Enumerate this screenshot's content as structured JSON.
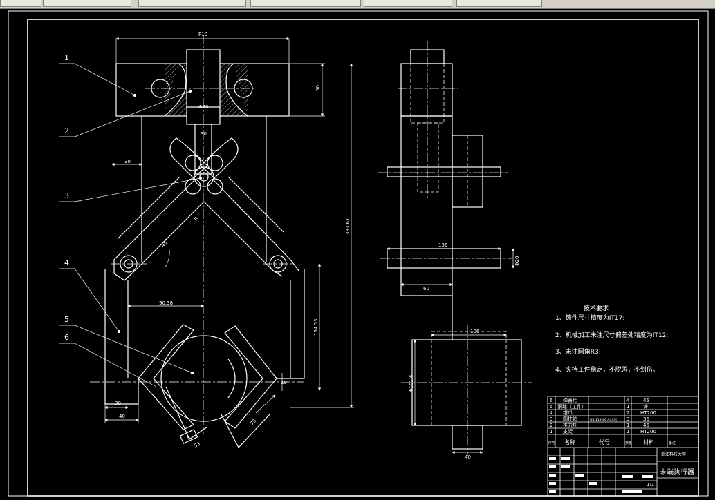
{
  "window": {
    "tabs": [
      "",
      "",
      "",
      "",
      "",
      ""
    ]
  },
  "dimensions": {
    "top_width": "P10",
    "height_50": "50",
    "bore": "Φ40",
    "slot_30": "30",
    "left_30": "30",
    "angle": "45°",
    "r": "R",
    "total_height": "333.61",
    "half_span": "90.38",
    "lower_height": "154.53",
    "bottom_30": "30",
    "bottom_40": "40",
    "jaw_78": "78",
    "jaw_5": "5",
    "jaw_53": "53",
    "gap_19": "19",
    "side_136": "136",
    "side_dia": "Φ20",
    "side_60": "60",
    "side_106": "106",
    "side_dia2": "Φ101.6",
    "side_40": "40"
  },
  "callouts": [
    "1",
    "2",
    "3",
    "4",
    "5",
    "6"
  ],
  "tech": {
    "title": "技术要求",
    "items": [
      "1、铸件尺寸精度为IT17;",
      "2、机械加工未注尺寸偏差处精度为IT12;",
      "3、未注圆角R3;",
      "4、夹持工件稳定，不脱落，不划伤。"
    ]
  },
  "bom": {
    "rows": [
      {
        "no": "6",
        "name": "弹簧片",
        "code": "",
        "qty": "4",
        "material": "45"
      },
      {
        "no": "5",
        "name": "钢球（工件）",
        "code": "",
        "qty": "1",
        "material": "铸"
      },
      {
        "no": "4",
        "name": "钳爪",
        "code": "",
        "qty": "2",
        "material": "HT200"
      },
      {
        "no": "3",
        "name": "圆柱销",
        "code": "GB 119-86 A4X30",
        "qty": "3",
        "material": "35"
      },
      {
        "no": "2",
        "name": "推力杆",
        "code": "",
        "qty": "1",
        "material": "45"
      },
      {
        "no": "1",
        "name": "支架",
        "code": "",
        "qty": "1",
        "material": "HT200"
      }
    ],
    "header": {
      "no": "序号",
      "name": "名称",
      "code": "代号",
      "qty": "数量",
      "material": "材料",
      "note": "备注"
    },
    "school": "浙江科技大学",
    "title": "末端执行器",
    "scale": "1:1"
  },
  "colors": {
    "bg": "#000000",
    "line": "#ffffff",
    "center": "#ffffff",
    "dim": "#ffffff"
  }
}
